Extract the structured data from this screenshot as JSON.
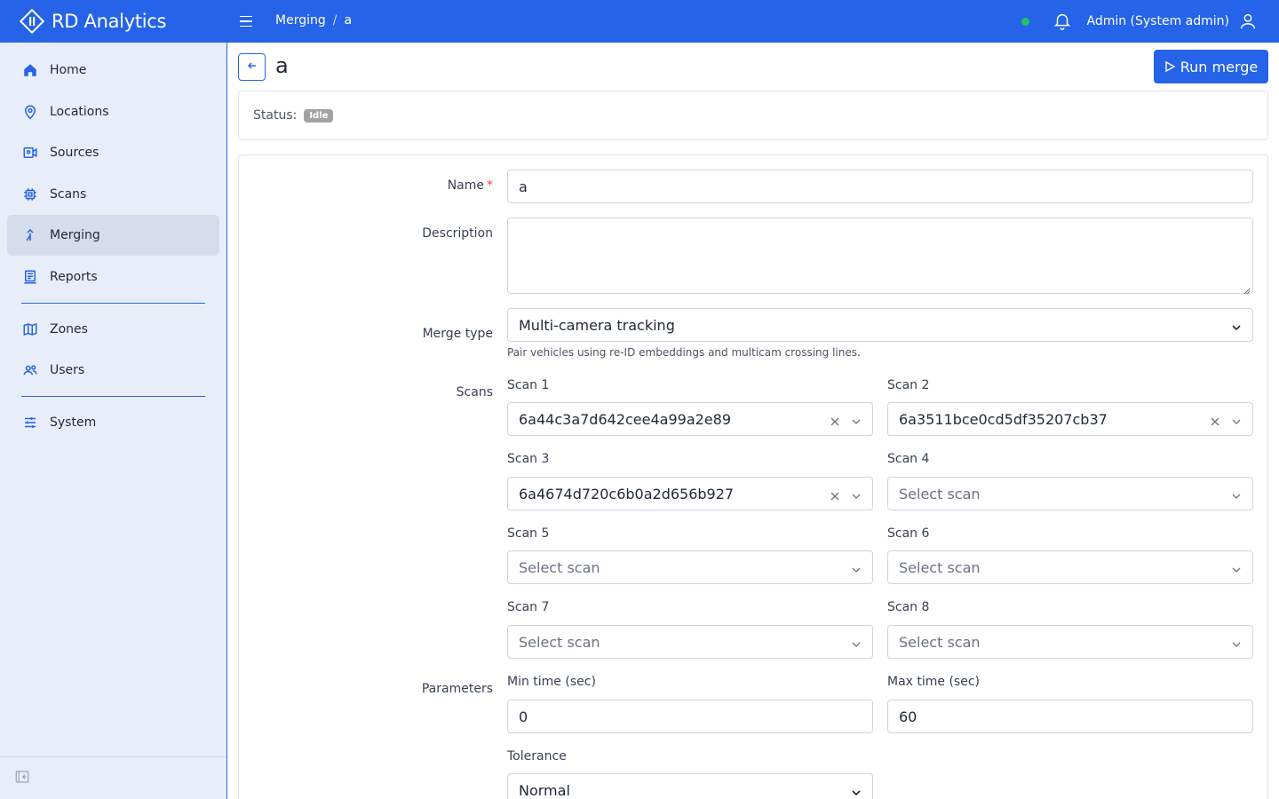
{
  "app": {
    "title": "RD Analytics"
  },
  "breadcrumb": {
    "section": "Merging",
    "separator": "/",
    "current": "a"
  },
  "header": {
    "user_label": "Admin (System admin)",
    "connection_status_color": "#22c55e"
  },
  "sidebar": {
    "items": [
      {
        "label": "Home",
        "icon": "home-icon"
      },
      {
        "label": "Locations",
        "icon": "map-pin-icon"
      },
      {
        "label": "Sources",
        "icon": "camera-icon"
      },
      {
        "label": "Scans",
        "icon": "chip-icon"
      },
      {
        "label": "Merging",
        "icon": "merge-icon",
        "active": true
      },
      {
        "label": "Reports",
        "icon": "report-icon"
      },
      {
        "label": "Zones",
        "icon": "map-icon"
      },
      {
        "label": "Users",
        "icon": "users-icon"
      },
      {
        "label": "System",
        "icon": "sliders-icon"
      }
    ]
  },
  "page": {
    "title": "a",
    "run_button_label": "Run merge",
    "status_label": "Status:",
    "status_badge": "Idle"
  },
  "form": {
    "name_label": "Name",
    "name_required_mark": "*",
    "name_value": "a",
    "description_label": "Description",
    "description_value": "",
    "merge_type_label": "Merge type",
    "merge_type_value": "Multi-camera tracking",
    "merge_type_hint": "Pair vehicles using re-ID embeddings and multicam crossing lines.",
    "scans_label": "Scans",
    "scans": [
      {
        "label": "Scan 1",
        "value": "6a44c3a7d642cee4a99a2e89"
      },
      {
        "label": "Scan 2",
        "value": "6a3511bce0cd5df35207cb37"
      },
      {
        "label": "Scan 3",
        "value": "6a4674d720c6b0a2d656b927"
      },
      {
        "label": "Scan 4",
        "placeholder": "Select scan"
      },
      {
        "label": "Scan 5",
        "placeholder": "Select scan"
      },
      {
        "label": "Scan 6",
        "placeholder": "Select scan"
      },
      {
        "label": "Scan 7",
        "placeholder": "Select scan"
      },
      {
        "label": "Scan 8",
        "placeholder": "Select scan"
      }
    ],
    "parameters_label": "Parameters",
    "min_time_label": "Min time (sec)",
    "min_time_value": "0",
    "max_time_label": "Max time (sec)",
    "max_time_value": "60",
    "tolerance_label": "Tolerance",
    "tolerance_value": "Normal"
  },
  "colors": {
    "brand": "#2563e8",
    "sidebar_bg": "#e8eef9",
    "badge_bg": "#a3a3a3"
  }
}
